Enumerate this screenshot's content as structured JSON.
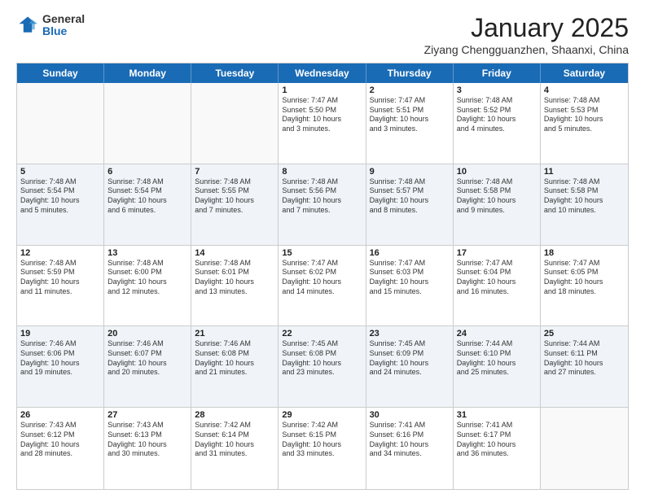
{
  "logo": {
    "general": "General",
    "blue": "Blue"
  },
  "title": "January 2025",
  "location": "Ziyang Chengguanzhen, Shaanxi, China",
  "days_of_week": [
    "Sunday",
    "Monday",
    "Tuesday",
    "Wednesday",
    "Thursday",
    "Friday",
    "Saturday"
  ],
  "weeks": [
    [
      {
        "day": "",
        "info": "",
        "empty": true
      },
      {
        "day": "",
        "info": "",
        "empty": true
      },
      {
        "day": "",
        "info": "",
        "empty": true
      },
      {
        "day": "1",
        "info": "Sunrise: 7:47 AM\nSunset: 5:50 PM\nDaylight: 10 hours\nand 3 minutes.",
        "empty": false
      },
      {
        "day": "2",
        "info": "Sunrise: 7:47 AM\nSunset: 5:51 PM\nDaylight: 10 hours\nand 3 minutes.",
        "empty": false
      },
      {
        "day": "3",
        "info": "Sunrise: 7:48 AM\nSunset: 5:52 PM\nDaylight: 10 hours\nand 4 minutes.",
        "empty": false
      },
      {
        "day": "4",
        "info": "Sunrise: 7:48 AM\nSunset: 5:53 PM\nDaylight: 10 hours\nand 5 minutes.",
        "empty": false
      }
    ],
    [
      {
        "day": "5",
        "info": "Sunrise: 7:48 AM\nSunset: 5:54 PM\nDaylight: 10 hours\nand 5 minutes.",
        "empty": false
      },
      {
        "day": "6",
        "info": "Sunrise: 7:48 AM\nSunset: 5:54 PM\nDaylight: 10 hours\nand 6 minutes.",
        "empty": false
      },
      {
        "day": "7",
        "info": "Sunrise: 7:48 AM\nSunset: 5:55 PM\nDaylight: 10 hours\nand 7 minutes.",
        "empty": false
      },
      {
        "day": "8",
        "info": "Sunrise: 7:48 AM\nSunset: 5:56 PM\nDaylight: 10 hours\nand 7 minutes.",
        "empty": false
      },
      {
        "day": "9",
        "info": "Sunrise: 7:48 AM\nSunset: 5:57 PM\nDaylight: 10 hours\nand 8 minutes.",
        "empty": false
      },
      {
        "day": "10",
        "info": "Sunrise: 7:48 AM\nSunset: 5:58 PM\nDaylight: 10 hours\nand 9 minutes.",
        "empty": false
      },
      {
        "day": "11",
        "info": "Sunrise: 7:48 AM\nSunset: 5:58 PM\nDaylight: 10 hours\nand 10 minutes.",
        "empty": false
      }
    ],
    [
      {
        "day": "12",
        "info": "Sunrise: 7:48 AM\nSunset: 5:59 PM\nDaylight: 10 hours\nand 11 minutes.",
        "empty": false
      },
      {
        "day": "13",
        "info": "Sunrise: 7:48 AM\nSunset: 6:00 PM\nDaylight: 10 hours\nand 12 minutes.",
        "empty": false
      },
      {
        "day": "14",
        "info": "Sunrise: 7:48 AM\nSunset: 6:01 PM\nDaylight: 10 hours\nand 13 minutes.",
        "empty": false
      },
      {
        "day": "15",
        "info": "Sunrise: 7:47 AM\nSunset: 6:02 PM\nDaylight: 10 hours\nand 14 minutes.",
        "empty": false
      },
      {
        "day": "16",
        "info": "Sunrise: 7:47 AM\nSunset: 6:03 PM\nDaylight: 10 hours\nand 15 minutes.",
        "empty": false
      },
      {
        "day": "17",
        "info": "Sunrise: 7:47 AM\nSunset: 6:04 PM\nDaylight: 10 hours\nand 16 minutes.",
        "empty": false
      },
      {
        "day": "18",
        "info": "Sunrise: 7:47 AM\nSunset: 6:05 PM\nDaylight: 10 hours\nand 18 minutes.",
        "empty": false
      }
    ],
    [
      {
        "day": "19",
        "info": "Sunrise: 7:46 AM\nSunset: 6:06 PM\nDaylight: 10 hours\nand 19 minutes.",
        "empty": false
      },
      {
        "day": "20",
        "info": "Sunrise: 7:46 AM\nSunset: 6:07 PM\nDaylight: 10 hours\nand 20 minutes.",
        "empty": false
      },
      {
        "day": "21",
        "info": "Sunrise: 7:46 AM\nSunset: 6:08 PM\nDaylight: 10 hours\nand 21 minutes.",
        "empty": false
      },
      {
        "day": "22",
        "info": "Sunrise: 7:45 AM\nSunset: 6:08 PM\nDaylight: 10 hours\nand 23 minutes.",
        "empty": false
      },
      {
        "day": "23",
        "info": "Sunrise: 7:45 AM\nSunset: 6:09 PM\nDaylight: 10 hours\nand 24 minutes.",
        "empty": false
      },
      {
        "day": "24",
        "info": "Sunrise: 7:44 AM\nSunset: 6:10 PM\nDaylight: 10 hours\nand 25 minutes.",
        "empty": false
      },
      {
        "day": "25",
        "info": "Sunrise: 7:44 AM\nSunset: 6:11 PM\nDaylight: 10 hours\nand 27 minutes.",
        "empty": false
      }
    ],
    [
      {
        "day": "26",
        "info": "Sunrise: 7:43 AM\nSunset: 6:12 PM\nDaylight: 10 hours\nand 28 minutes.",
        "empty": false
      },
      {
        "day": "27",
        "info": "Sunrise: 7:43 AM\nSunset: 6:13 PM\nDaylight: 10 hours\nand 30 minutes.",
        "empty": false
      },
      {
        "day": "28",
        "info": "Sunrise: 7:42 AM\nSunset: 6:14 PM\nDaylight: 10 hours\nand 31 minutes.",
        "empty": false
      },
      {
        "day": "29",
        "info": "Sunrise: 7:42 AM\nSunset: 6:15 PM\nDaylight: 10 hours\nand 33 minutes.",
        "empty": false
      },
      {
        "day": "30",
        "info": "Sunrise: 7:41 AM\nSunset: 6:16 PM\nDaylight: 10 hours\nand 34 minutes.",
        "empty": false
      },
      {
        "day": "31",
        "info": "Sunrise: 7:41 AM\nSunset: 6:17 PM\nDaylight: 10 hours\nand 36 minutes.",
        "empty": false
      },
      {
        "day": "",
        "info": "",
        "empty": true
      }
    ]
  ]
}
